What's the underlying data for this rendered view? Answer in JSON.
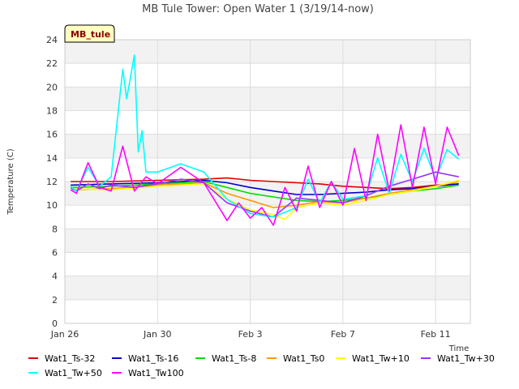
{
  "chart_data": {
    "type": "line",
    "title": "MB Tule Tower: Open Water 1 (3/19/14-now)",
    "xlabel": "Time",
    "ylabel": "Temperature (C)",
    "station_tag": "MB_tule",
    "xlim": [
      "2014-01-26",
      "2014-02-12T12:00"
    ],
    "ylim": [
      0,
      24
    ],
    "x_ticks": [
      {
        "x": "2014-01-26",
        "label": "Jan 26"
      },
      {
        "x": "2014-01-30",
        "label": "Jan 30"
      },
      {
        "x": "2014-02-03",
        "label": "Feb 3"
      },
      {
        "x": "2014-02-07",
        "label": "Feb 7"
      },
      {
        "x": "2014-02-11",
        "label": "Feb 11"
      }
    ],
    "y_ticks": [
      0,
      2,
      4,
      6,
      8,
      10,
      12,
      14,
      16,
      18,
      20,
      22,
      24
    ],
    "grid": true,
    "legend_position": "bottom",
    "series": [
      {
        "name": "Wat1_Ts-32",
        "color": "#e00000",
        "x": [
          "2014-01-26T06:00",
          "2014-01-28",
          "2014-01-30",
          "2014-02-01",
          "2014-02-02",
          "2014-02-03",
          "2014-02-04",
          "2014-02-05",
          "2014-02-06",
          "2014-02-07",
          "2014-02-08",
          "2014-02-09",
          "2014-02-10",
          "2014-02-11",
          "2014-02-12"
        ],
        "y": [
          12.0,
          12.0,
          12.1,
          12.2,
          12.3,
          12.1,
          12.0,
          11.9,
          11.8,
          11.6,
          11.5,
          11.4,
          11.5,
          11.7,
          11.8
        ]
      },
      {
        "name": "Wat1_Ts-16",
        "color": "#0000cc",
        "x": [
          "2014-01-26T06:00",
          "2014-01-28",
          "2014-01-30",
          "2014-02-01",
          "2014-02-02",
          "2014-02-03",
          "2014-02-04",
          "2014-02-05",
          "2014-02-06",
          "2014-02-07",
          "2014-02-08",
          "2014-02-09",
          "2014-02-10",
          "2014-02-11",
          "2014-02-12"
        ],
        "y": [
          11.7,
          11.8,
          11.9,
          12.1,
          11.9,
          11.5,
          11.2,
          10.9,
          10.9,
          11.0,
          11.1,
          11.3,
          11.4,
          11.6,
          11.8
        ]
      },
      {
        "name": "Wat1_Ts-8",
        "color": "#00dd00",
        "x": [
          "2014-01-26T06:00",
          "2014-01-28",
          "2014-01-30",
          "2014-02-01",
          "2014-02-02",
          "2014-02-03",
          "2014-02-04",
          "2014-02-05",
          "2014-02-06",
          "2014-02-07",
          "2014-02-08",
          "2014-02-09",
          "2014-02-10",
          "2014-02-11",
          "2014-02-12"
        ],
        "y": [
          11.5,
          11.6,
          11.8,
          12.0,
          11.5,
          11.0,
          10.7,
          10.4,
          10.3,
          10.4,
          10.6,
          10.9,
          11.2,
          11.4,
          11.7
        ]
      },
      {
        "name": "Wat1_Ts0",
        "color": "#ff9900",
        "x": [
          "2014-01-26T06:00",
          "2014-01-28",
          "2014-01-30",
          "2014-02-01",
          "2014-02-02",
          "2014-02-03",
          "2014-02-04",
          "2014-02-05",
          "2014-02-06",
          "2014-02-07",
          "2014-02-08",
          "2014-02-09",
          "2014-02-10",
          "2014-02-11",
          "2014-02-12"
        ],
        "y": [
          11.3,
          11.4,
          11.7,
          11.9,
          11.0,
          10.4,
          9.8,
          10.0,
          10.3,
          10.2,
          10.6,
          11.0,
          11.3,
          11.6,
          12.0
        ]
      },
      {
        "name": "Wat1_Tw+10",
        "color": "#ffff00",
        "x": [
          "2014-01-26T06:00",
          "2014-01-28",
          "2014-01-30",
          "2014-02-01",
          "2014-02-02",
          "2014-02-03",
          "2014-02-04",
          "2014-02-04T12:00",
          "2014-02-05",
          "2014-02-06",
          "2014-02-07",
          "2014-02-08",
          "2014-02-09",
          "2014-02-10",
          "2014-02-11",
          "2014-02-12"
        ],
        "y": [
          11.4,
          11.3,
          11.6,
          11.8,
          10.5,
          9.6,
          9.2,
          8.8,
          9.8,
          10.2,
          10.0,
          10.4,
          10.9,
          11.2,
          11.6,
          12.1
        ]
      },
      {
        "name": "Wat1_Tw+30",
        "color": "#9933ff",
        "x": [
          "2014-01-26T06:00",
          "2014-01-26T12:00",
          "2014-01-27",
          "2014-01-27T12:00",
          "2014-01-28",
          "2014-01-29",
          "2014-01-30",
          "2014-01-31",
          "2014-02-01",
          "2014-02-02",
          "2014-02-03",
          "2014-02-04",
          "2014-02-05",
          "2014-02-06",
          "2014-02-07",
          "2014-02-08",
          "2014-02-09",
          "2014-02-10",
          "2014-02-11",
          "2014-02-12"
        ],
        "y": [
          11.5,
          11.2,
          11.8,
          11.4,
          11.7,
          11.5,
          11.8,
          12.2,
          11.9,
          10.2,
          9.5,
          9.0,
          10.6,
          10.4,
          10.2,
          10.8,
          11.6,
          12.2,
          12.8,
          12.4
        ]
      },
      {
        "name": "Wat1_Tw+50",
        "color": "#00ffff",
        "x": [
          "2014-01-26T06:00",
          "2014-01-26T12:00",
          "2014-01-27",
          "2014-01-27T12:00",
          "2014-01-28",
          "2014-01-28T12:00",
          "2014-01-28T16:00",
          "2014-01-29",
          "2014-01-29T04:00",
          "2014-01-29T08:00",
          "2014-01-29T12:00",
          "2014-01-30",
          "2014-01-31",
          "2014-02-01",
          "2014-02-02",
          "2014-02-03",
          "2014-02-04",
          "2014-02-05",
          "2014-02-05T12:00",
          "2014-02-06",
          "2014-02-06T12:00",
          "2014-02-07",
          "2014-02-08",
          "2014-02-08T12:00",
          "2014-02-09",
          "2014-02-09T12:00",
          "2014-02-10",
          "2014-02-10T12:00",
          "2014-02-11",
          "2014-02-11T12:00",
          "2014-02-12"
        ],
        "y": [
          11.6,
          11.2,
          13.2,
          11.6,
          12.4,
          21.5,
          19.0,
          22.7,
          14.5,
          16.3,
          12.8,
          12.8,
          13.5,
          12.8,
          10.5,
          9.3,
          9.0,
          9.8,
          12.2,
          10.2,
          12.0,
          10.5,
          10.8,
          14.0,
          11.0,
          14.3,
          12.0,
          14.8,
          12.2,
          14.7,
          13.9
        ]
      },
      {
        "name": "Wat1_Tw100",
        "color": "#ff00ff",
        "x": [
          "2014-01-26T06:00",
          "2014-01-26T12:00",
          "2014-01-27",
          "2014-01-27T12:00",
          "2014-01-28",
          "2014-01-28T12:00",
          "2014-01-29",
          "2014-01-29T12:00",
          "2014-01-30",
          "2014-01-31",
          "2014-02-01",
          "2014-02-02",
          "2014-02-02T12:00",
          "2014-02-03",
          "2014-02-03T12:00",
          "2014-02-04",
          "2014-02-04T12:00",
          "2014-02-05",
          "2014-02-05T12:00",
          "2014-02-06",
          "2014-02-06T12:00",
          "2014-02-07",
          "2014-02-07T12:00",
          "2014-02-08",
          "2014-02-08T12:00",
          "2014-02-09",
          "2014-02-09T12:00",
          "2014-02-10",
          "2014-02-10T12:00",
          "2014-02-11",
          "2014-02-11T12:00",
          "2014-02-12"
        ],
        "y": [
          11.3,
          11.0,
          13.6,
          11.5,
          11.2,
          15.0,
          11.2,
          12.4,
          11.8,
          13.2,
          11.9,
          8.7,
          10.2,
          8.9,
          9.8,
          8.3,
          11.5,
          9.5,
          13.3,
          9.8,
          12.0,
          10.0,
          14.8,
          10.4,
          16.0,
          11.2,
          16.8,
          11.5,
          16.6,
          11.8,
          16.6,
          14.2
        ]
      }
    ]
  }
}
